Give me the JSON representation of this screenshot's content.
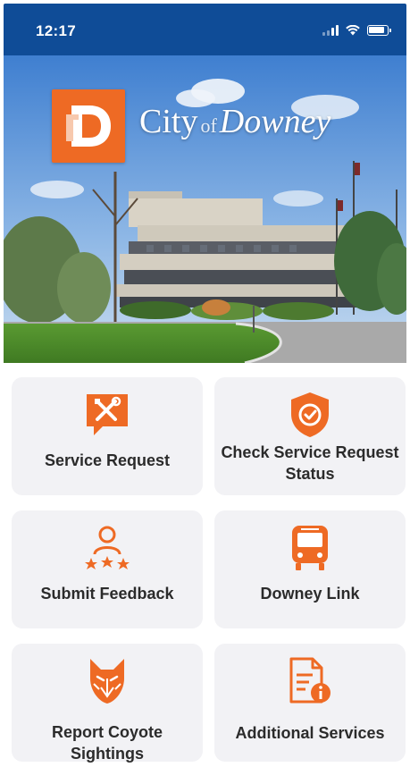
{
  "status_bar": {
    "time": "12:17",
    "icons": [
      "signal-icon",
      "wifi-icon",
      "battery-icon"
    ]
  },
  "hero": {
    "logo_letter": "D",
    "city_word": "City",
    "of_word": "of",
    "name_word": "Downey"
  },
  "tiles": [
    {
      "label": "Service Request",
      "icon": "repair-chat-icon"
    },
    {
      "label": "Check Service Request Status",
      "icon": "shield-check-icon"
    },
    {
      "label": "Submit Feedback",
      "icon": "person-stars-icon"
    },
    {
      "label": "Downey Link",
      "icon": "bus-icon"
    },
    {
      "label": "Report Coyote Sightings",
      "icon": "coyote-icon"
    },
    {
      "label": "Additional Services",
      "icon": "document-info-icon"
    }
  ],
  "colors": {
    "status_bar": "#0f4c97",
    "accent": "#ee6a24",
    "tile_bg": "#f2f2f5",
    "tile_text": "#2b2b2b"
  }
}
